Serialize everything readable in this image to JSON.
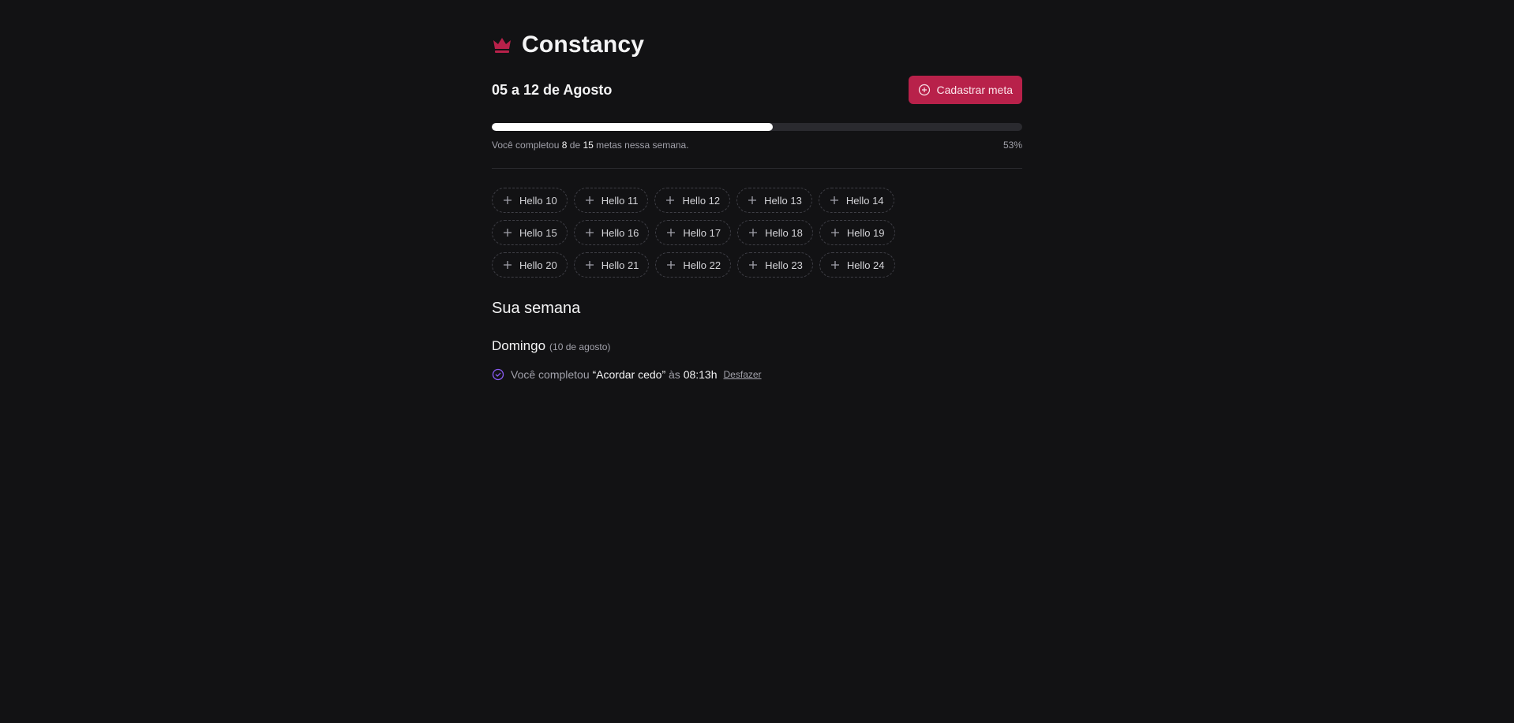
{
  "brand": {
    "name": "Constancy",
    "icon": "crown-icon",
    "color": "#b8214a"
  },
  "header": {
    "week_title": "05 a 12 de Agosto",
    "add_goal_label": "Cadastrar meta",
    "add_goal_icon": "plus-circle-icon",
    "accent_color": "#b8214a"
  },
  "progress": {
    "completed": "8",
    "total": "15",
    "percent": 53,
    "percent_label": "53%",
    "text_before": "Você completou",
    "text_middle": "de",
    "text_after": "metas nessa semana."
  },
  "pending_goals": [
    {
      "label": "Hello 10"
    },
    {
      "label": "Hello 11"
    },
    {
      "label": "Hello 12"
    },
    {
      "label": "Hello 13"
    },
    {
      "label": "Hello 14"
    },
    {
      "label": "Hello 15"
    },
    {
      "label": "Hello 16"
    },
    {
      "label": "Hello 17"
    },
    {
      "label": "Hello 18"
    },
    {
      "label": "Hello 19"
    },
    {
      "label": "Hello 20"
    },
    {
      "label": "Hello 21"
    },
    {
      "label": "Hello 22"
    },
    {
      "label": "Hello 23"
    },
    {
      "label": "Hello 24"
    }
  ],
  "week_summary": {
    "title": "Sua semana",
    "days": [
      {
        "name": "Domingo",
        "date": "(10 de agosto)",
        "entries": [
          {
            "prefix": "Você completou",
            "goal": "“Acordar cedo”",
            "middle": "às",
            "time": "08:13h",
            "undo_label": "Desfazer",
            "icon": "check-circle-icon"
          }
        ]
      }
    ]
  }
}
